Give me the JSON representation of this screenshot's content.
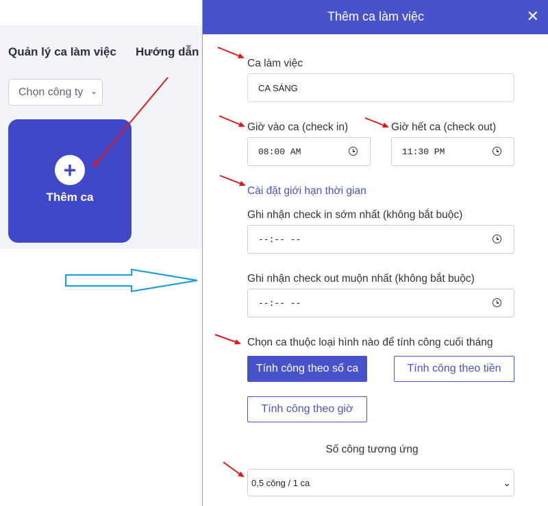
{
  "left_app": {
    "tabs": [
      "Quản lý ca làm việc",
      "Hướng dẫn"
    ],
    "company_select": {
      "value": "Chọn công ty"
    },
    "add_card": {
      "icon": "plus-icon",
      "label": "Thêm ca"
    }
  },
  "modal": {
    "title": "Thêm ca làm việc",
    "close_icon": "close-icon",
    "shift_name": {
      "label": "Ca làm việc",
      "value": "CA SÁNG"
    },
    "check_in": {
      "label": "Giờ vào ca (check in)",
      "value": "08:00 AM"
    },
    "check_out": {
      "label": "Giờ hết ca (check out)",
      "value": "11:30 PM"
    },
    "time_limit_link": "Cài đặt giới hạn thời gian",
    "earliest_check_in": {
      "label": "Ghi nhận check in sớm nhất (không bắt buộc)",
      "value": "--:-- --"
    },
    "latest_check_out": {
      "label": "Ghi nhận check out muộn nhất (không bắt buộc)",
      "value": "--:-- --"
    },
    "calc_type": {
      "label": "Chọn ca thuộc loại hình nào để tính công cuối tháng",
      "options": [
        "Tính công theo số ca",
        "Tính công theo tiền",
        "Tính công theo giờ"
      ],
      "selected": "Tính công theo số ca"
    },
    "work_units": {
      "label": "Số công tương ứng",
      "value": "0,5 công / 1 ca"
    }
  },
  "annotations": {
    "arrow_color": "#e01818",
    "flow_arrow_color": "#1da1d8"
  }
}
